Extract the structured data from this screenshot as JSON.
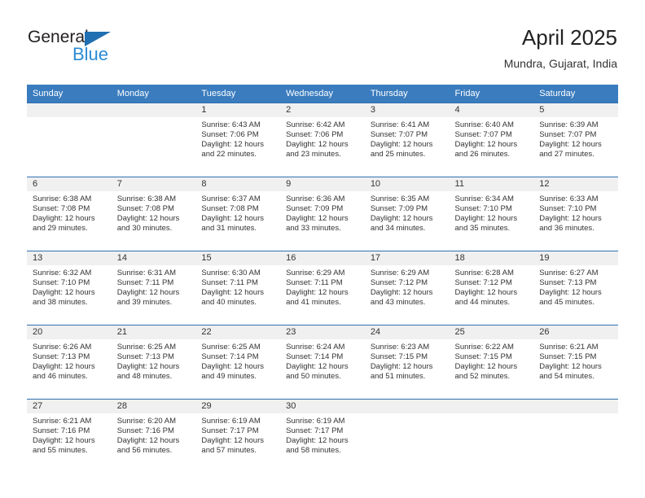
{
  "brand": {
    "name_part1": "General",
    "name_part2": "Blue",
    "triangle_color": "#1f6fb2",
    "blue_color": "#2b8bd4"
  },
  "header": {
    "title": "April 2025",
    "subtitle": "Mundra, Gujarat, India"
  },
  "theme": {
    "header_bg": "#3a7cbe",
    "row_divider": "#2f6fb0",
    "daynum_bg": "#f0f0f0"
  },
  "weekday_headers": [
    "Sunday",
    "Monday",
    "Tuesday",
    "Wednesday",
    "Thursday",
    "Friday",
    "Saturday"
  ],
  "labels": {
    "sunrise_prefix": "Sunrise:",
    "sunset_prefix": "Sunset:",
    "daylight_prefix": "Daylight:"
  },
  "weeks": [
    [
      {
        "day": "",
        "sunrise": "",
        "sunset": "",
        "daylight_line1": "",
        "daylight_line2": ""
      },
      {
        "day": "",
        "sunrise": "",
        "sunset": "",
        "daylight_line1": "",
        "daylight_line2": ""
      },
      {
        "day": "1",
        "sunrise": "Sunrise: 6:43 AM",
        "sunset": "Sunset: 7:06 PM",
        "daylight_line1": "Daylight: 12 hours",
        "daylight_line2": "and 22 minutes."
      },
      {
        "day": "2",
        "sunrise": "Sunrise: 6:42 AM",
        "sunset": "Sunset: 7:06 PM",
        "daylight_line1": "Daylight: 12 hours",
        "daylight_line2": "and 23 minutes."
      },
      {
        "day": "3",
        "sunrise": "Sunrise: 6:41 AM",
        "sunset": "Sunset: 7:07 PM",
        "daylight_line1": "Daylight: 12 hours",
        "daylight_line2": "and 25 minutes."
      },
      {
        "day": "4",
        "sunrise": "Sunrise: 6:40 AM",
        "sunset": "Sunset: 7:07 PM",
        "daylight_line1": "Daylight: 12 hours",
        "daylight_line2": "and 26 minutes."
      },
      {
        "day": "5",
        "sunrise": "Sunrise: 6:39 AM",
        "sunset": "Sunset: 7:07 PM",
        "daylight_line1": "Daylight: 12 hours",
        "daylight_line2": "and 27 minutes."
      }
    ],
    [
      {
        "day": "6",
        "sunrise": "Sunrise: 6:38 AM",
        "sunset": "Sunset: 7:08 PM",
        "daylight_line1": "Daylight: 12 hours",
        "daylight_line2": "and 29 minutes."
      },
      {
        "day": "7",
        "sunrise": "Sunrise: 6:38 AM",
        "sunset": "Sunset: 7:08 PM",
        "daylight_line1": "Daylight: 12 hours",
        "daylight_line2": "and 30 minutes."
      },
      {
        "day": "8",
        "sunrise": "Sunrise: 6:37 AM",
        "sunset": "Sunset: 7:08 PM",
        "daylight_line1": "Daylight: 12 hours",
        "daylight_line2": "and 31 minutes."
      },
      {
        "day": "9",
        "sunrise": "Sunrise: 6:36 AM",
        "sunset": "Sunset: 7:09 PM",
        "daylight_line1": "Daylight: 12 hours",
        "daylight_line2": "and 33 minutes."
      },
      {
        "day": "10",
        "sunrise": "Sunrise: 6:35 AM",
        "sunset": "Sunset: 7:09 PM",
        "daylight_line1": "Daylight: 12 hours",
        "daylight_line2": "and 34 minutes."
      },
      {
        "day": "11",
        "sunrise": "Sunrise: 6:34 AM",
        "sunset": "Sunset: 7:10 PM",
        "daylight_line1": "Daylight: 12 hours",
        "daylight_line2": "and 35 minutes."
      },
      {
        "day": "12",
        "sunrise": "Sunrise: 6:33 AM",
        "sunset": "Sunset: 7:10 PM",
        "daylight_line1": "Daylight: 12 hours",
        "daylight_line2": "and 36 minutes."
      }
    ],
    [
      {
        "day": "13",
        "sunrise": "Sunrise: 6:32 AM",
        "sunset": "Sunset: 7:10 PM",
        "daylight_line1": "Daylight: 12 hours",
        "daylight_line2": "and 38 minutes."
      },
      {
        "day": "14",
        "sunrise": "Sunrise: 6:31 AM",
        "sunset": "Sunset: 7:11 PM",
        "daylight_line1": "Daylight: 12 hours",
        "daylight_line2": "and 39 minutes."
      },
      {
        "day": "15",
        "sunrise": "Sunrise: 6:30 AM",
        "sunset": "Sunset: 7:11 PM",
        "daylight_line1": "Daylight: 12 hours",
        "daylight_line2": "and 40 minutes."
      },
      {
        "day": "16",
        "sunrise": "Sunrise: 6:29 AM",
        "sunset": "Sunset: 7:11 PM",
        "daylight_line1": "Daylight: 12 hours",
        "daylight_line2": "and 41 minutes."
      },
      {
        "day": "17",
        "sunrise": "Sunrise: 6:29 AM",
        "sunset": "Sunset: 7:12 PM",
        "daylight_line1": "Daylight: 12 hours",
        "daylight_line2": "and 43 minutes."
      },
      {
        "day": "18",
        "sunrise": "Sunrise: 6:28 AM",
        "sunset": "Sunset: 7:12 PM",
        "daylight_line1": "Daylight: 12 hours",
        "daylight_line2": "and 44 minutes."
      },
      {
        "day": "19",
        "sunrise": "Sunrise: 6:27 AM",
        "sunset": "Sunset: 7:13 PM",
        "daylight_line1": "Daylight: 12 hours",
        "daylight_line2": "and 45 minutes."
      }
    ],
    [
      {
        "day": "20",
        "sunrise": "Sunrise: 6:26 AM",
        "sunset": "Sunset: 7:13 PM",
        "daylight_line1": "Daylight: 12 hours",
        "daylight_line2": "and 46 minutes."
      },
      {
        "day": "21",
        "sunrise": "Sunrise: 6:25 AM",
        "sunset": "Sunset: 7:13 PM",
        "daylight_line1": "Daylight: 12 hours",
        "daylight_line2": "and 48 minutes."
      },
      {
        "day": "22",
        "sunrise": "Sunrise: 6:25 AM",
        "sunset": "Sunset: 7:14 PM",
        "daylight_line1": "Daylight: 12 hours",
        "daylight_line2": "and 49 minutes."
      },
      {
        "day": "23",
        "sunrise": "Sunrise: 6:24 AM",
        "sunset": "Sunset: 7:14 PM",
        "daylight_line1": "Daylight: 12 hours",
        "daylight_line2": "and 50 minutes."
      },
      {
        "day": "24",
        "sunrise": "Sunrise: 6:23 AM",
        "sunset": "Sunset: 7:15 PM",
        "daylight_line1": "Daylight: 12 hours",
        "daylight_line2": "and 51 minutes."
      },
      {
        "day": "25",
        "sunrise": "Sunrise: 6:22 AM",
        "sunset": "Sunset: 7:15 PM",
        "daylight_line1": "Daylight: 12 hours",
        "daylight_line2": "and 52 minutes."
      },
      {
        "day": "26",
        "sunrise": "Sunrise: 6:21 AM",
        "sunset": "Sunset: 7:15 PM",
        "daylight_line1": "Daylight: 12 hours",
        "daylight_line2": "and 54 minutes."
      }
    ],
    [
      {
        "day": "27",
        "sunrise": "Sunrise: 6:21 AM",
        "sunset": "Sunset: 7:16 PM",
        "daylight_line1": "Daylight: 12 hours",
        "daylight_line2": "and 55 minutes."
      },
      {
        "day": "28",
        "sunrise": "Sunrise: 6:20 AM",
        "sunset": "Sunset: 7:16 PM",
        "daylight_line1": "Daylight: 12 hours",
        "daylight_line2": "and 56 minutes."
      },
      {
        "day": "29",
        "sunrise": "Sunrise: 6:19 AM",
        "sunset": "Sunset: 7:17 PM",
        "daylight_line1": "Daylight: 12 hours",
        "daylight_line2": "and 57 minutes."
      },
      {
        "day": "30",
        "sunrise": "Sunrise: 6:19 AM",
        "sunset": "Sunset: 7:17 PM",
        "daylight_line1": "Daylight: 12 hours",
        "daylight_line2": "and 58 minutes."
      },
      {
        "day": "",
        "sunrise": "",
        "sunset": "",
        "daylight_line1": "",
        "daylight_line2": ""
      },
      {
        "day": "",
        "sunrise": "",
        "sunset": "",
        "daylight_line1": "",
        "daylight_line2": ""
      },
      {
        "day": "",
        "sunrise": "",
        "sunset": "",
        "daylight_line1": "",
        "daylight_line2": ""
      }
    ]
  ]
}
